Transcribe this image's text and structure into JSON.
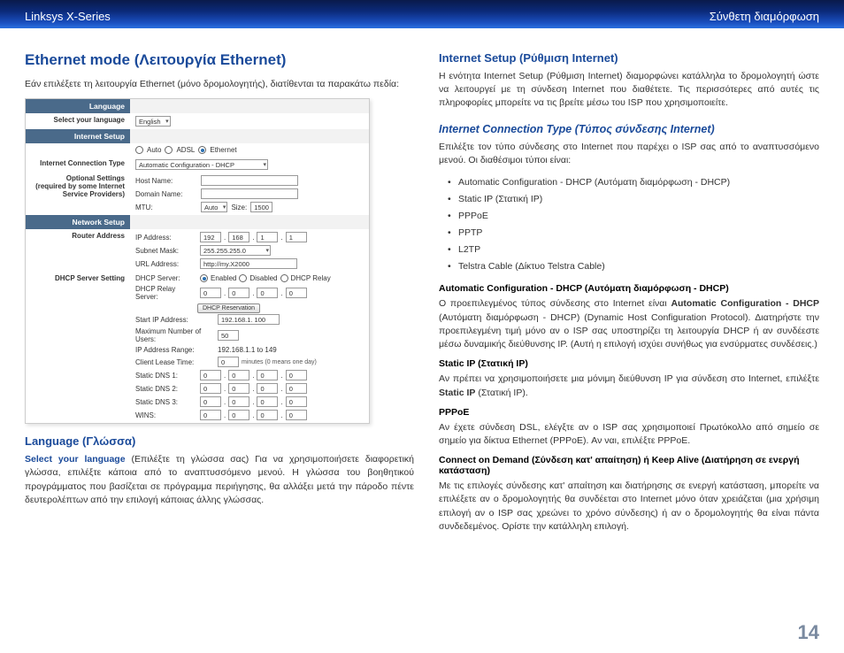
{
  "topbar": {
    "left": "Linksys X-Series",
    "right": "Σύνθετη διαμόρφωση"
  },
  "left": {
    "heading": "Ethernet mode (Λειτουργία Ethernet)",
    "intro": "Εάν επιλέξετε τη λειτουργία Ethernet (μόνο δρομολογητής), διατίθενται τα παρακάτω πεδία:",
    "shot": {
      "hdr_language": "Language",
      "lbl_select_lang": "Select your language",
      "val_lang": "English",
      "hdr_internet": "Internet Setup",
      "opt_auto": "Auto",
      "opt_adsl": "ADSL",
      "opt_eth": "Ethernet",
      "lbl_ict": "Internet Connection Type",
      "val_ict": "Automatic Configuration - DHCP",
      "lbl_optional": "Optional Settings\n(required by some Internet Service Providers)",
      "lbl_host": "Host Name:",
      "lbl_domain": "Domain Name:",
      "lbl_mtu": "MTU:",
      "val_mtu": "Auto",
      "lbl_size": "Size:",
      "val_size": "1500",
      "hdr_network": "Network Setup",
      "lbl_router": "Router Address",
      "lbl_ip": "IP Address:",
      "ip1": "192",
      "ip2": "168",
      "ip3": "1",
      "ip4": "1",
      "lbl_mask": "Subnet Mask:",
      "val_mask": "255.255.255.0",
      "lbl_url": "URL Address:",
      "val_url": "http://my.X2000",
      "lbl_dhcp_setting": "DHCP Server Setting",
      "lbl_dhcp_server": "DHCP Server:",
      "opt_en": "Enabled",
      "opt_dis": "Disabled",
      "opt_relay": "DHCP Relay",
      "lbl_dhcp_relay": "DHCP Relay Server:",
      "rs1": "0",
      "rs2": "0",
      "rs3": "0",
      "rs4": "0",
      "btn_reserve": "DHCP Reservation",
      "lbl_start": "Start IP Address:",
      "val_start": "192.168.1. 100",
      "lbl_max": "Maximum Number of Users:",
      "val_max": "50",
      "lbl_range": "IP Address Range:",
      "val_range": "192.168.1.1 to 149",
      "lbl_lease": "Client Lease Time:",
      "val_lease": "0",
      "note_lease": "minutes (0 means one day)",
      "lbl_d1": "Static DNS 1:",
      "lbl_d2": "Static DNS 2:",
      "lbl_d3": "Static DNS 3:",
      "lbl_wins": "WINS:",
      "z": "0"
    },
    "lang_heading": "Language (Γλώσσα)",
    "lang_para_lead": "Select your language",
    "lang_para_rest": " (Επιλέξτε τη γλώσσα σας) Για να χρησιμοποιήσετε διαφορετική γλώσσα, επιλέξτε κάποια από το αναπτυσσόμενο μενού. Η γλώσσα του βοηθητικού προγράμματος που βασίζεται σε πρόγραμμα περιήγησης, θα αλλάξει μετά την πάροδο πέντε δευτερολέπτων από την επιλογή κάποιας άλλης γλώσσας."
  },
  "right": {
    "heading": "Internet Setup (Ρύθμιση Internet)",
    "intro": "Η ενότητα Internet Setup (Ρύθμιση Internet) διαμορφώνει κατάλληλα το δρομολογητή ώστε να λειτουργεί με τη σύνδεση Internet που διαθέτετε. Τις περισσότερες από αυτές τις πληροφορίες μπορείτε να τις βρείτε μέσω του ISP που χρησιμοποιείτε.",
    "ict_heading": "Internet Connection Type (Τύπος σύνδεσης Internet)",
    "ict_intro": "Επιλέξτε τον τύπο σύνδεσης στο Internet που παρέχει ο ISP σας από το αναπτυσσόμενο μενού. Οι διαθέσιμοι τύποι είναι:",
    "types": [
      "Automatic Configuration - DHCP (Αυτόματη διαμόρφωση - DHCP)",
      "Static IP (Στατική IP)",
      "PPPoE",
      "PPTP",
      "L2TP",
      "Telstra Cable (Δίκτυο Telstra Cable)"
    ],
    "h_dhcp": "Automatic Configuration - DHCP (Αυτόματη διαμόρφωση - DHCP)",
    "p_dhcp_1a": "Ο προεπιλεγμένος τύπος σύνδεσης στο Internet είναι ",
    "p_dhcp_1b": "Automatic Configuration - DHCP",
    "p_dhcp_1c": " (Αυτόματη διαμόρφωση - DHCP) (Dynamic Host Configuration Protocol). Διατηρήστε την προεπιλεγμένη τιμή μόνο αν ο ISP σας υποστηρίζει τη λειτουργία DHCP ή αν συνδέεστε μέσω δυναμικής διεύθυνσης IP. (Αυτή η επιλογή ισχύει συνήθως για ενσύρματες συνδέσεις.)",
    "h_static": "Static IP (Στατική IP)",
    "p_static_a": "Αν πρέπει να χρησιμοποιήσετε μια μόνιμη διεύθυνση IP για σύνδεση στο Internet, επιλέξτε ",
    "p_static_b": "Static IP",
    "p_static_c": " (Στατική IP).",
    "h_pppoe": "PPPoE",
    "p_pppoe": "Αν έχετε σύνδεση DSL, ελέγξτε αν ο ISP σας χρησιμοποιεί Πρωτόκολλο από σημείο σε σημείο για δίκτυα Ethernet (PPPoE). Αν ναι, επιλέξτε PPPoE.",
    "h_cod": "Connect on Demand (Σύνδεση κατ' απαίτηση) ή Keep Alive (Διατήρηση σε ενεργή κατάσταση)",
    "p_cod": "Με τις επιλογές σύνδεσης κατ' απαίτηση και διατήρησης σε ενεργή κατάσταση, μπορείτε να επιλέξετε αν ο δρομολογητής θα συνδέεται στο Internet μόνο όταν χρειάζεται (μια χρήσιμη επιλογή αν ο ISP σας χρεώνει το χρόνο σύνδεσης) ή αν ο δρομολογητής θα είναι πάντα συνδεδεμένος. Ορίστε την κατάλληλη επιλογή."
  },
  "pagenum": "14"
}
